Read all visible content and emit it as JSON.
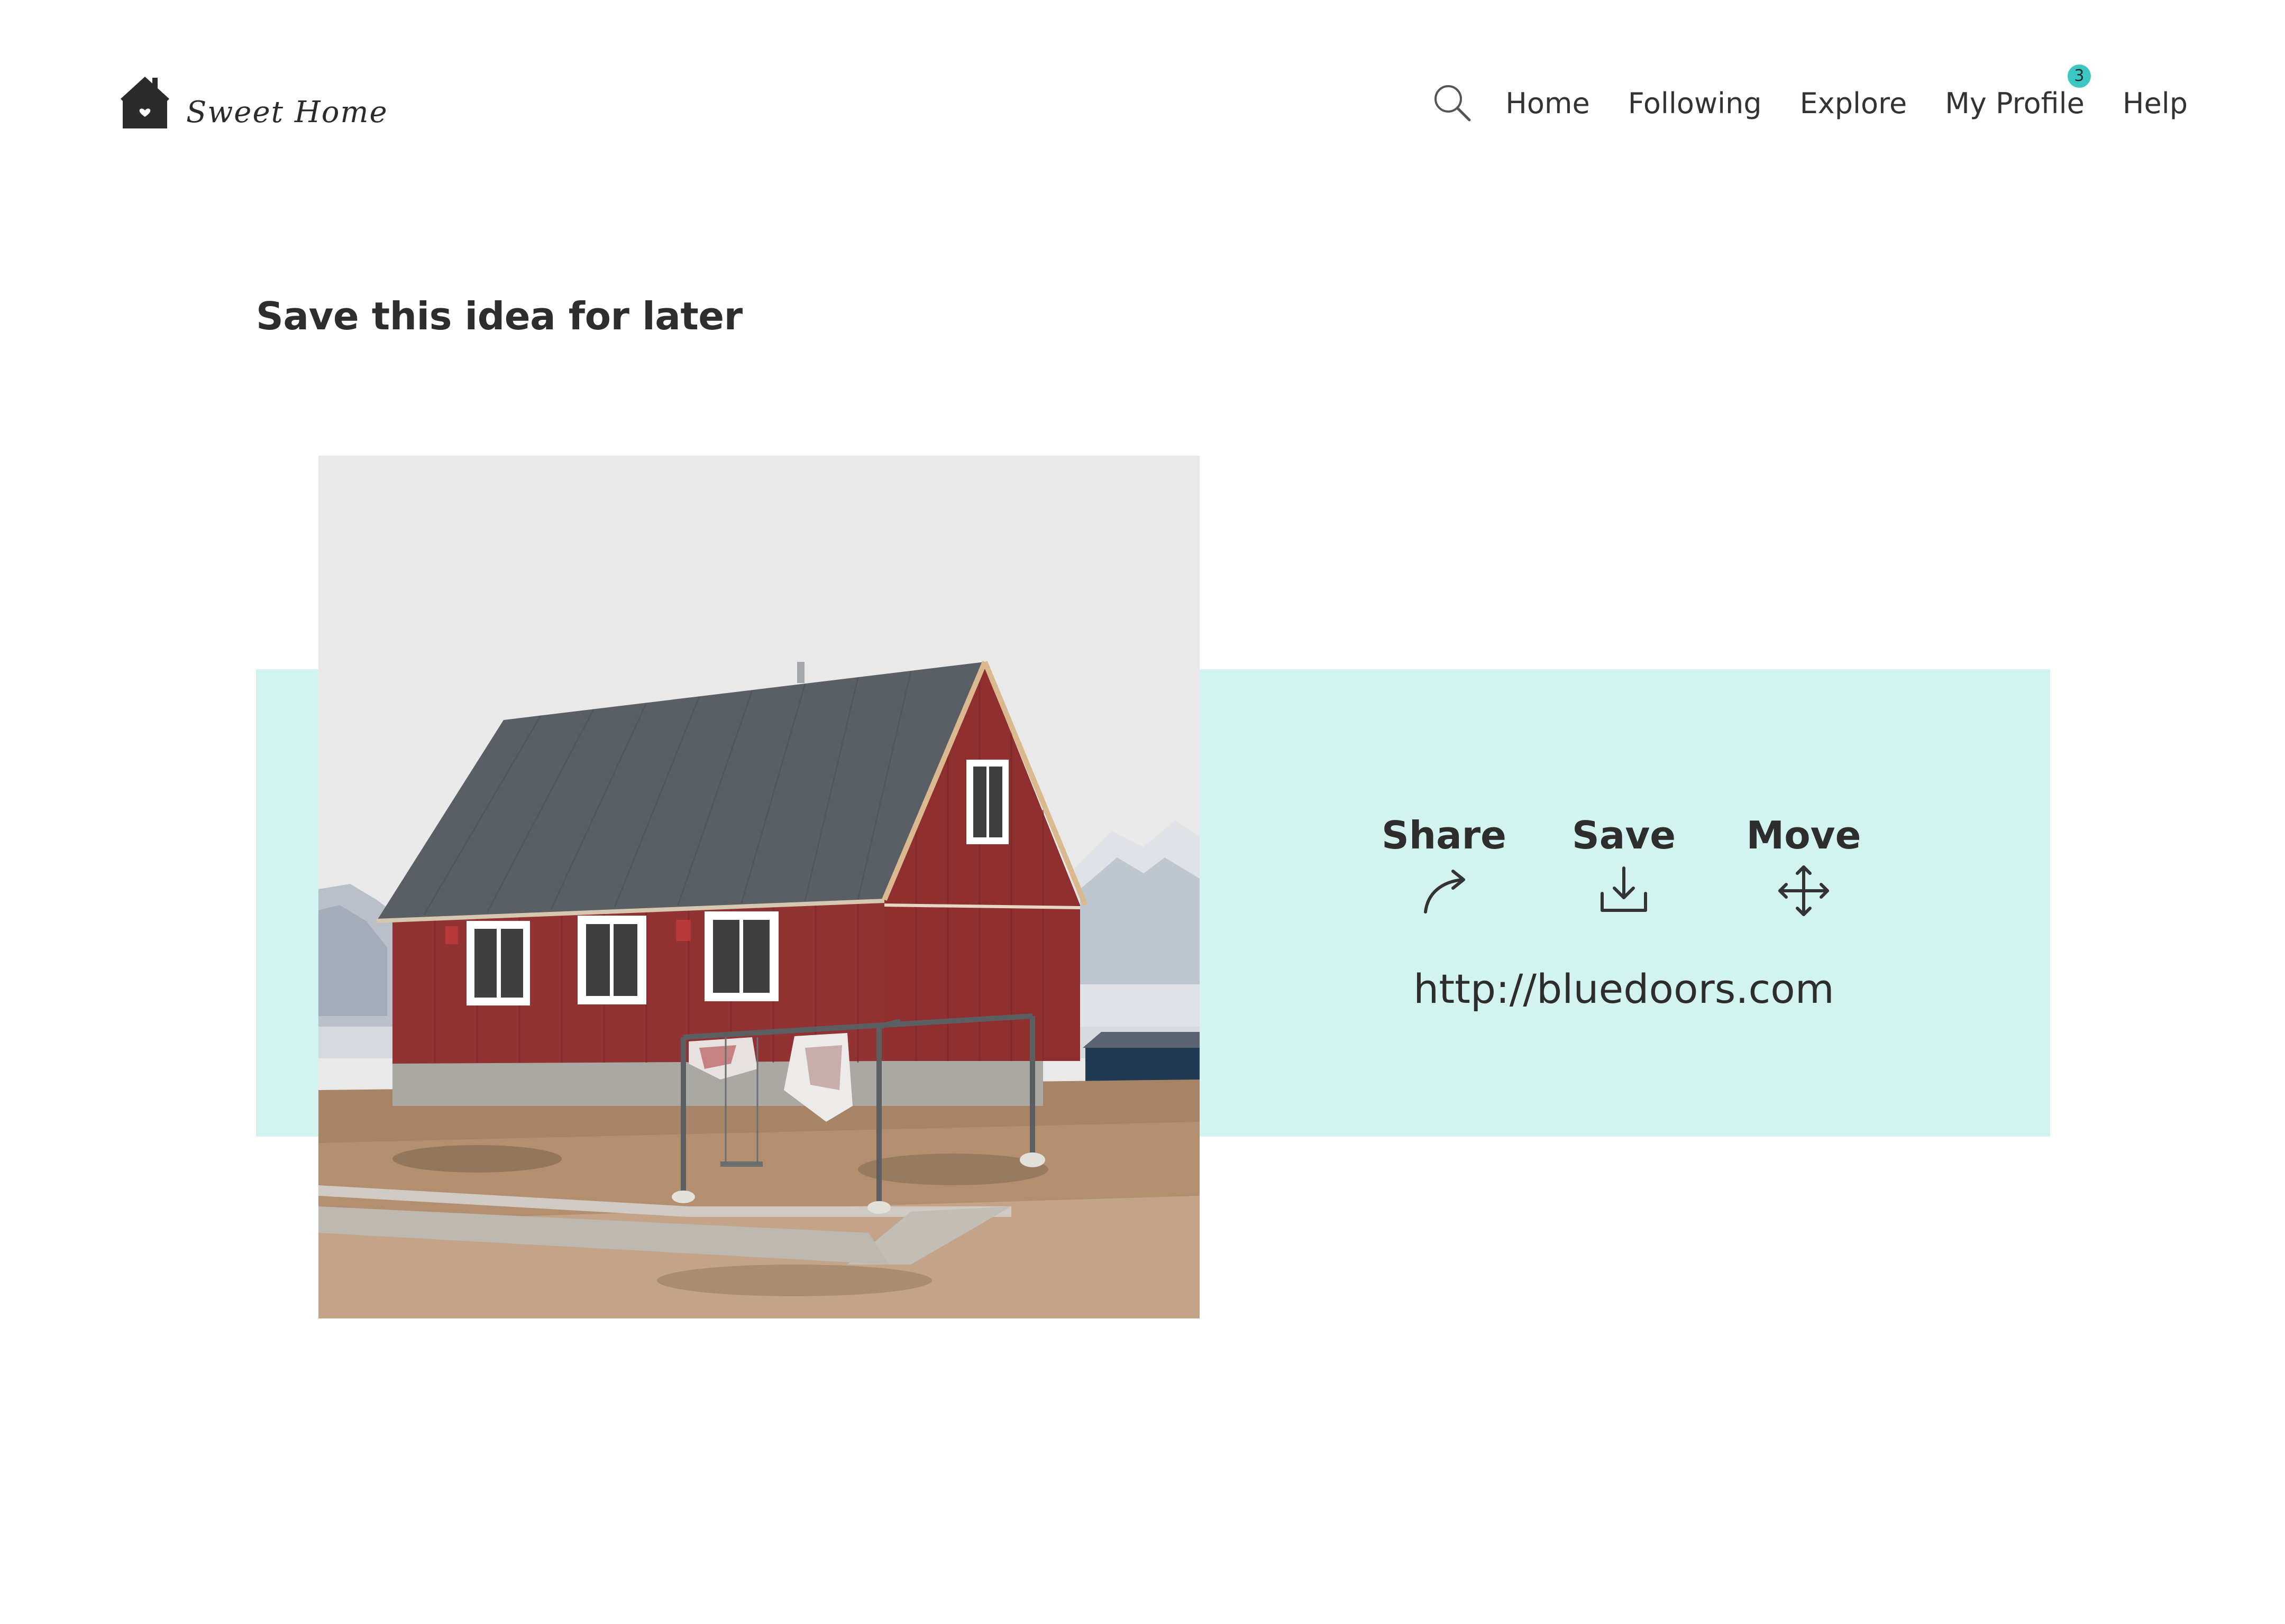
{
  "brand": {
    "name": "Sweet Home",
    "logo_icon": "house-heart-icon"
  },
  "nav": {
    "search_icon": "search-icon",
    "items": [
      {
        "label": "Home"
      },
      {
        "label": "Following"
      },
      {
        "label": "Explore"
      },
      {
        "label": "My Profile",
        "badge": "3"
      },
      {
        "label": "Help"
      }
    ]
  },
  "page": {
    "title": "Save this idea for later"
  },
  "card": {
    "image_subject": "red-house-photo",
    "actions": [
      {
        "label": "Share",
        "icon": "share-arrow-icon"
      },
      {
        "label": "Save",
        "icon": "download-icon"
      },
      {
        "label": "Move",
        "icon": "move-arrows-icon"
      }
    ],
    "source_url": "http://bluedoors.com"
  },
  "colors": {
    "accent_mint": "#d2f3ef",
    "badge_teal": "#3cc7c3",
    "text_dark": "#2d2d2d"
  }
}
